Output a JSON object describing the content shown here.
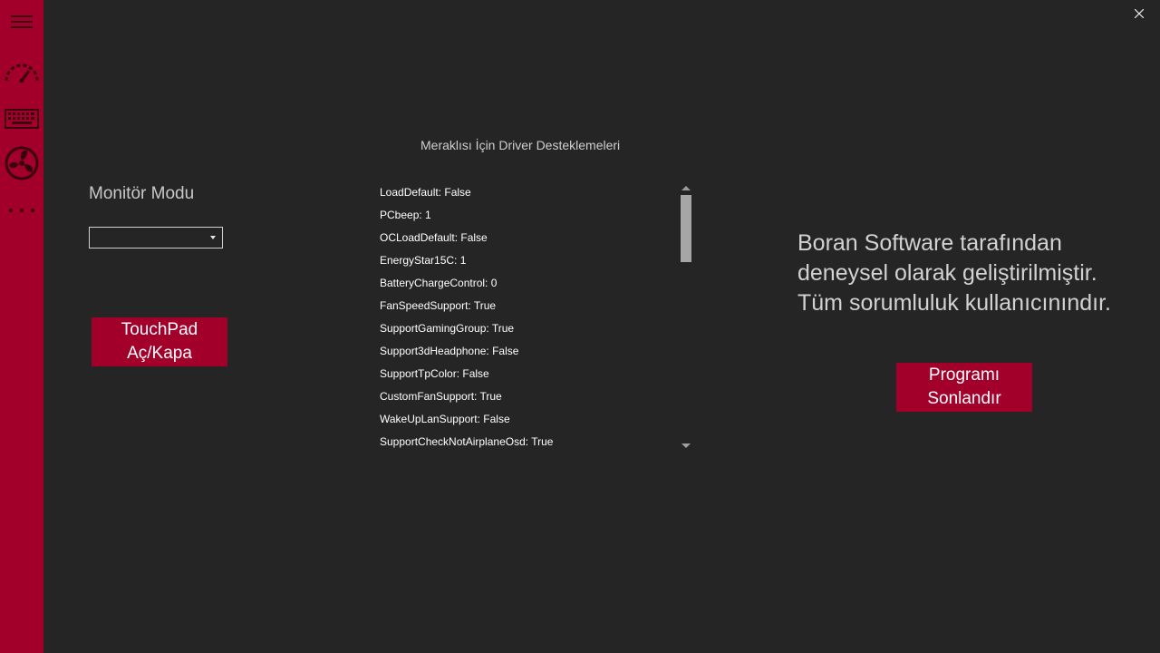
{
  "sidebar": {
    "items": [
      {
        "icon": "hamburger-menu-icon"
      },
      {
        "icon": "speedometer-icon"
      },
      {
        "icon": "keyboard-icon"
      },
      {
        "icon": "fan-icon"
      },
      {
        "icon": "more-dots-icon"
      }
    ],
    "accent_color": "#a2002a"
  },
  "window": {
    "close_icon": "close-icon"
  },
  "monitor": {
    "label": "Monitör Modu",
    "selected_value": ""
  },
  "touchpad_button": {
    "line1": "TouchPad",
    "line2": "Aç/Kapa"
  },
  "driver_support": {
    "title": "Meraklısı İçin Driver Desteklemeleri",
    "items": [
      "LoadDefault: False",
      "PCbeep: 1",
      "OCLoadDefault: False",
      "EnergyStar15C: 1",
      "BatteryChargeControl: 0",
      "FanSpeedSupport: True",
      "SupportGamingGroup: True",
      "Support3dHeadphone: False",
      "SupportTpColor: False",
      "CustomFanSupport: True",
      "WakeUpLanSupport: False",
      "SupportCheckNotAirplaneOsd: True"
    ]
  },
  "disclaimer": {
    "line1": "Boran Software tarafından",
    "line2": "deneysel olarak geliştirilmiştir.",
    "line3": "Tüm sorumluluk kullanıcınındır."
  },
  "end_button": {
    "line1": "Programı",
    "line2": "Sonlandır"
  }
}
